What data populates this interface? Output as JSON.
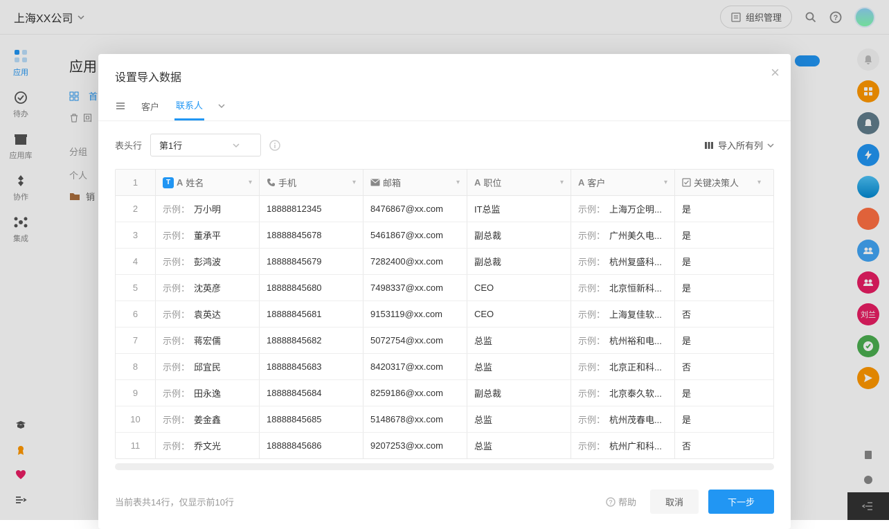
{
  "topbar": {
    "company": "上海XX公司",
    "org_button": "组织管理"
  },
  "leftbar": {
    "items": [
      {
        "label": "应用"
      },
      {
        "label": "待办"
      },
      {
        "label": "应用库"
      },
      {
        "label": "协作"
      },
      {
        "label": "集成"
      }
    ]
  },
  "main": {
    "title": "应用",
    "add_button": "+",
    "tab_home": "首",
    "recycle": "回",
    "group": "分组",
    "personal": "个人",
    "folder": "销"
  },
  "rightbar_user": "刘兰",
  "modal": {
    "title": "设置导入数据",
    "tabs": {
      "customer": "客户",
      "contact": "联系人"
    },
    "header_row_label": "表头行",
    "header_row_value": "第1行",
    "import_all": "导入所有列",
    "columns": [
      {
        "label": "姓名",
        "type": "text",
        "is_title": true
      },
      {
        "label": "手机",
        "type": "phone"
      },
      {
        "label": "邮箱",
        "type": "email"
      },
      {
        "label": "职位",
        "type": "text"
      },
      {
        "label": "客户",
        "type": "text"
      },
      {
        "label": "关键决策人",
        "type": "check"
      }
    ],
    "example_prefix": "示例：",
    "rows": [
      {
        "idx": "2",
        "name": "万小明",
        "phone": "18888812345",
        "email": "8476867@xx.com",
        "pos": "IT总监",
        "cust": "上海万企明...",
        "key": "是"
      },
      {
        "idx": "3",
        "name": "董承平",
        "phone": "18888845678",
        "email": "5461867@xx.com",
        "pos": "副总裁",
        "cust": "广州美久电...",
        "key": "是"
      },
      {
        "idx": "4",
        "name": "彭鸿波",
        "phone": "18888845679",
        "email": "7282400@xx.com",
        "pos": "副总裁",
        "cust": "杭州复盛科...",
        "key": "是"
      },
      {
        "idx": "5",
        "name": "沈英彦",
        "phone": "18888845680",
        "email": "7498337@xx.com",
        "pos": "CEO",
        "cust": "北京恒新科...",
        "key": "是"
      },
      {
        "idx": "6",
        "name": "袁英达",
        "phone": "18888845681",
        "email": "9153119@xx.com",
        "pos": "CEO",
        "cust": "上海复佳软...",
        "key": "否"
      },
      {
        "idx": "7",
        "name": "蒋宏儒",
        "phone": "18888845682",
        "email": "5072754@xx.com",
        "pos": "总监",
        "cust": "杭州裕和电...",
        "key": "是"
      },
      {
        "idx": "8",
        "name": "邱宜民",
        "phone": "18888845683",
        "email": "8420317@xx.com",
        "pos": "总监",
        "cust": "北京正和科...",
        "key": "否"
      },
      {
        "idx": "9",
        "name": "田永逸",
        "phone": "18888845684",
        "email": "8259186@xx.com",
        "pos": "副总裁",
        "cust": "北京泰久软...",
        "key": "是"
      },
      {
        "idx": "10",
        "name": "姜金鑫",
        "phone": "18888845685",
        "email": "5148678@xx.com",
        "pos": "总监",
        "cust": "杭州茂春电...",
        "key": "是"
      },
      {
        "idx": "11",
        "name": "乔文光",
        "phone": "18888845686",
        "email": "9207253@xx.com",
        "pos": "总监",
        "cust": "杭州广和科...",
        "key": "否"
      }
    ],
    "status": "当前表共14行，仅显示前10行",
    "help": "帮助",
    "cancel": "取消",
    "next": "下一步"
  }
}
